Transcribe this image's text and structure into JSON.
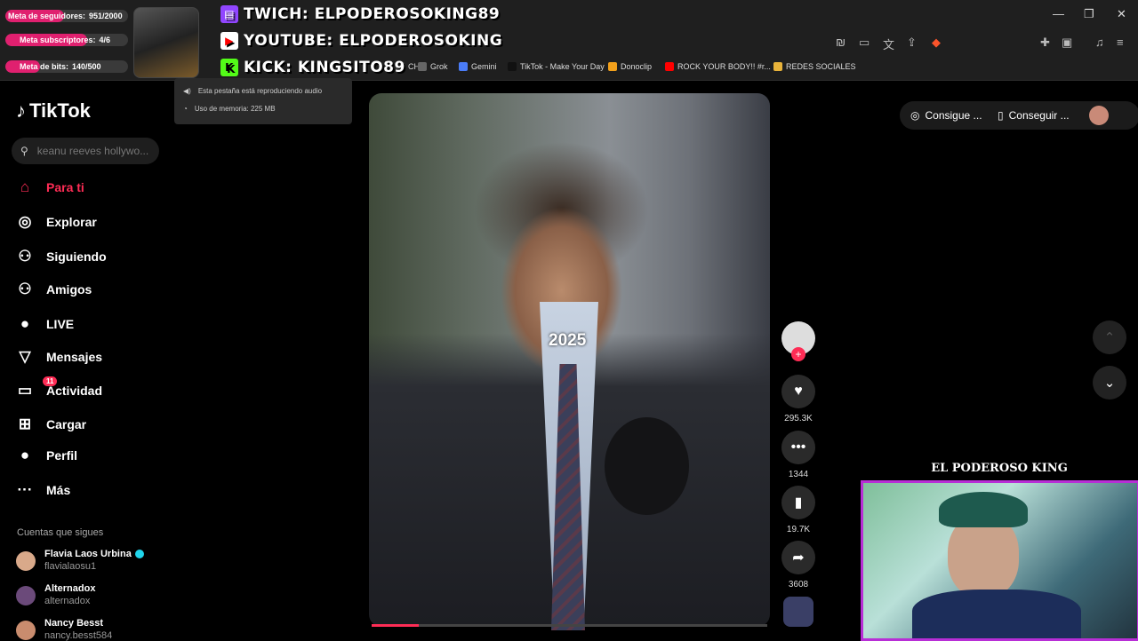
{
  "stream_overlay": {
    "goals": [
      {
        "label": "Meta de seguidores:",
        "value": "951/2000",
        "progress": 0.4755
      },
      {
        "label": "Meta subscriptores:",
        "value": "4/6",
        "progress": 0.6667
      },
      {
        "label": "Meta de bits:",
        "value": "140/500",
        "progress": 0.28
      }
    ],
    "socials": [
      {
        "platform_icon": "twitch-icon",
        "text": "TWICH: ELPODEROSOKING89",
        "color": "#9146ff"
      },
      {
        "platform_icon": "youtube-icon",
        "text": "YOUTUBE: ELPODEROSOKING",
        "color": "#ff0000"
      },
      {
        "platform_icon": "kick-icon",
        "text": "KICK: KINGSITO89",
        "color": "#53fc18"
      }
    ],
    "webcam_title": "EL PODEROSO KING"
  },
  "browser": {
    "tab_tooltip": {
      "audio": "Esta pestaña está reproduciendo audio",
      "memory": "Uso de memoria: 225 MB"
    },
    "bookmarks": [
      {
        "label": "CH",
        "color": "#444"
      },
      {
        "label": "Grok",
        "color": "#666"
      },
      {
        "label": "Gemini",
        "color": "#4a7cf7"
      },
      {
        "label": "TikTok - Make Your Day",
        "color": "#111"
      },
      {
        "label": "Donoclip",
        "color": "#f2a01b"
      },
      {
        "label": "ROCK YOUR BODY!! #r...",
        "color": "#ff0000"
      },
      {
        "label": "REDES SOCIALES",
        "color": "#e8b33a"
      }
    ],
    "window_controls": {
      "minimize": "—",
      "restore": "❐",
      "close": "✕"
    }
  },
  "tiktok": {
    "brand": "TikTok",
    "search_placeholder": "keanu reeves hollywo...",
    "nav": [
      {
        "label": "Para ti",
        "icon": "home-icon",
        "glyph": "⌂"
      },
      {
        "label": "Explorar",
        "icon": "compass-icon",
        "glyph": "◎"
      },
      {
        "label": "Siguiendo",
        "icon": "following-icon",
        "glyph": "⚇"
      },
      {
        "label": "Amigos",
        "icon": "friends-icon",
        "glyph": "⚇"
      },
      {
        "label": "LIVE",
        "icon": "live-icon",
        "glyph": "●"
      },
      {
        "label": "Mensajes",
        "icon": "messages-icon",
        "glyph": "▽"
      },
      {
        "label": "Actividad",
        "icon": "activity-icon",
        "glyph": "▭",
        "badge": "11"
      },
      {
        "label": "Cargar",
        "icon": "upload-icon",
        "glyph": "⊞"
      },
      {
        "label": "Perfil",
        "icon": "profile-icon",
        "glyph": "●"
      },
      {
        "label": "Más",
        "icon": "more-icon",
        "glyph": "···"
      }
    ],
    "following_title": "Cuentas que sigues",
    "following": [
      {
        "name": "Flavia Laos Urbina",
        "handle": "flavialaosu1",
        "verified": true
      },
      {
        "name": "Alternadox",
        "handle": "alternadox",
        "verified": false
      },
      {
        "name": "Nancy Besst",
        "handle": "nancy.besst584",
        "verified": false
      }
    ],
    "video": {
      "overlay_text": "2025",
      "progress": 0.12,
      "likes": "295.3K",
      "comments": "1344",
      "saves": "19.7K",
      "shares": "3608"
    },
    "top_right": {
      "coins": "Consigue ...",
      "app": "Conseguir ..."
    }
  }
}
